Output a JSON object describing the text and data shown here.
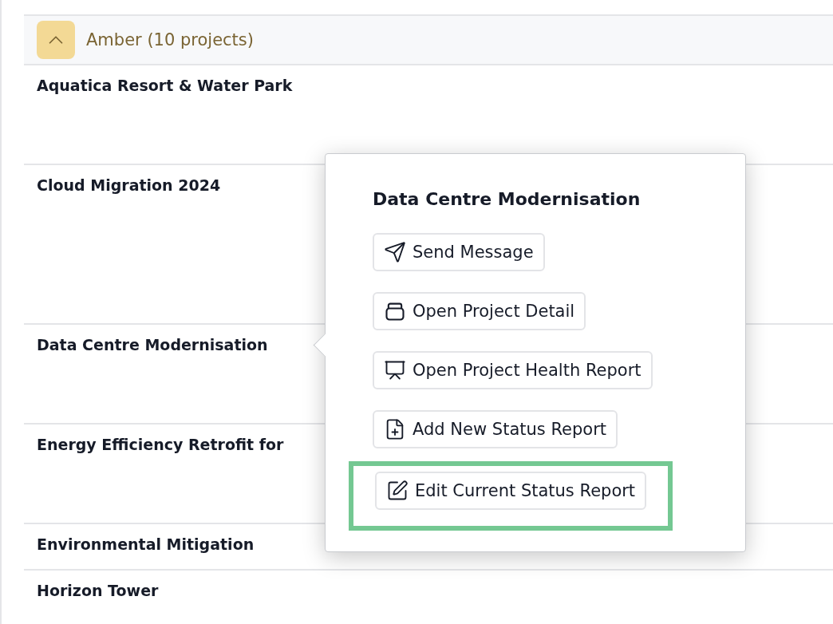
{
  "group": {
    "label": "Amber (10 projects)",
    "expanded": true
  },
  "rows": [
    {
      "name": "Aquatica Resort & Water Park"
    },
    {
      "name": "Cloud Migration 2024"
    },
    {
      "name": "Data Centre Modernisation"
    },
    {
      "name": "Energy Efficiency Retrofit for"
    },
    {
      "name": "Environmental Mitigation"
    },
    {
      "name": "Horizon Tower"
    }
  ],
  "popover": {
    "title": "Data Centre Modernisation",
    "actions": [
      {
        "label": "Send Message",
        "kind": "send",
        "highlighted": false
      },
      {
        "label": "Open Project Detail",
        "kind": "detail",
        "highlighted": false
      },
      {
        "label": "Open Project Health Report",
        "kind": "health",
        "highlighted": false
      },
      {
        "label": "Add New Status Report",
        "kind": "add",
        "highlighted": false
      },
      {
        "label": "Edit Current Status Report",
        "kind": "edit",
        "highlighted": true
      }
    ]
  }
}
